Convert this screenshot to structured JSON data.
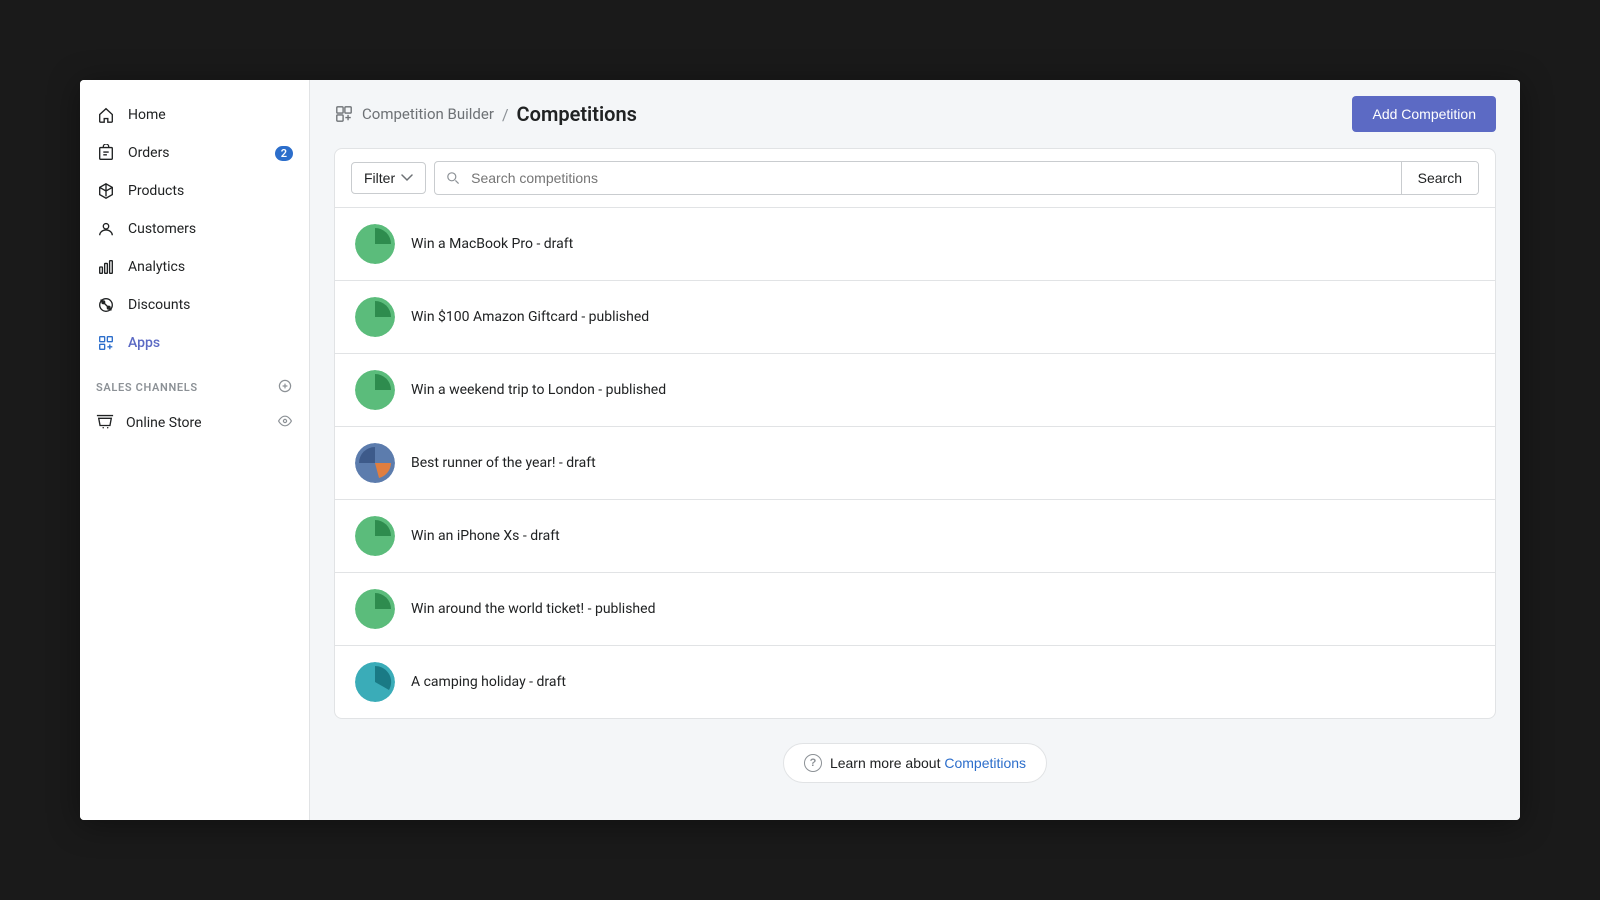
{
  "sidebar": {
    "items": [
      {
        "id": "home",
        "label": "Home",
        "icon": "home"
      },
      {
        "id": "orders",
        "label": "Orders",
        "icon": "orders",
        "badge": "2"
      },
      {
        "id": "products",
        "label": "Products",
        "icon": "products"
      },
      {
        "id": "customers",
        "label": "Customers",
        "icon": "customers"
      },
      {
        "id": "analytics",
        "label": "Analytics",
        "icon": "analytics"
      },
      {
        "id": "discounts",
        "label": "Discounts",
        "icon": "discounts"
      },
      {
        "id": "apps",
        "label": "Apps",
        "icon": "apps",
        "active": true
      }
    ],
    "sales_channels_title": "SALES CHANNELS",
    "online_store_label": "Online Store"
  },
  "topbar": {
    "breadcrumb_root": "Competition Builder",
    "breadcrumb_separator": "/",
    "breadcrumb_current": "Competitions",
    "add_button_label": "Add Competition"
  },
  "search": {
    "filter_label": "Filter",
    "placeholder": "Search competitions",
    "search_button_label": "Search"
  },
  "competitions": [
    {
      "id": 1,
      "name": "Win a MacBook Pro - draft",
      "avatar_type": "green_pie"
    },
    {
      "id": 2,
      "name": "Win $100 Amazon Giftcard - published",
      "avatar_type": "green_pie"
    },
    {
      "id": 3,
      "name": "Win a weekend trip to London - published",
      "avatar_type": "green_pie"
    },
    {
      "id": 4,
      "name": "Best runner of the year! - draft",
      "avatar_type": "blue_orange"
    },
    {
      "id": 5,
      "name": "Win an iPhone Xs - draft",
      "avatar_type": "green_pie"
    },
    {
      "id": 6,
      "name": "Win around the world ticket! - published",
      "avatar_type": "green_pie"
    },
    {
      "id": 7,
      "name": "A camping holiday - draft",
      "avatar_type": "teal_pie"
    }
  ],
  "footer": {
    "learn_more_text": "Learn more about ",
    "learn_more_link": "Competitions"
  }
}
